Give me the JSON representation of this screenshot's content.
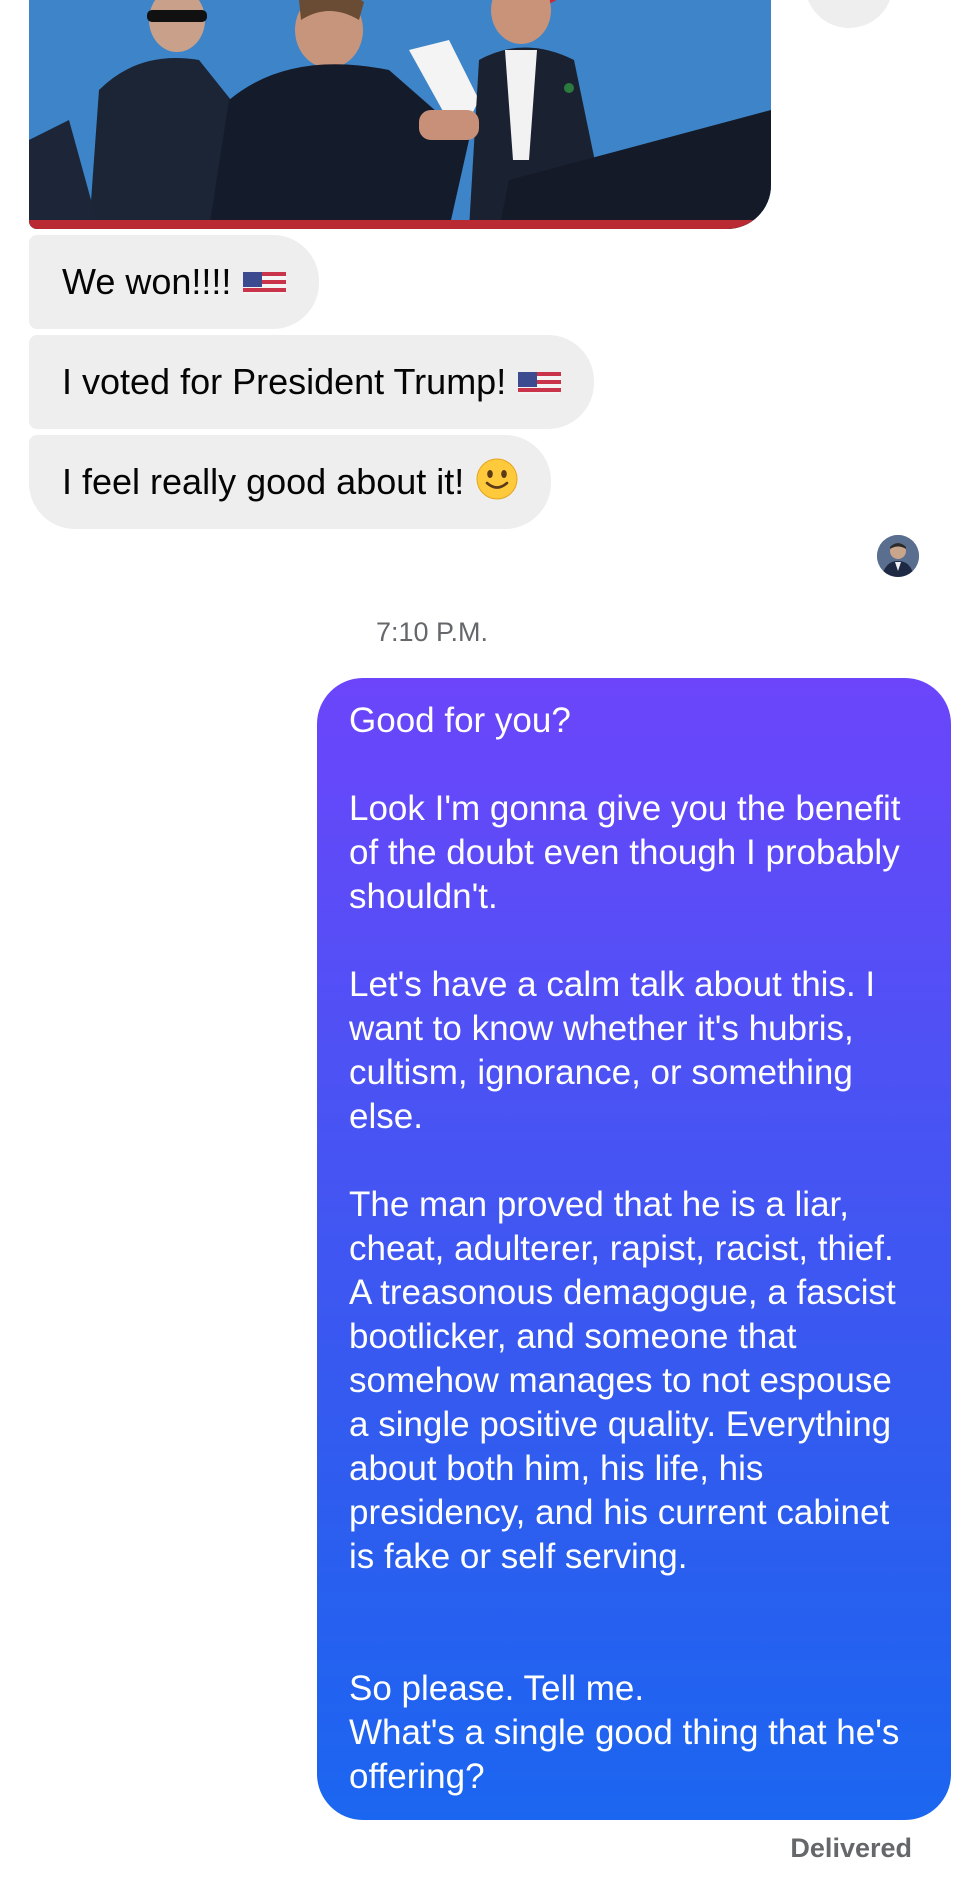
{
  "conversation": {
    "incoming": [
      {
        "text": "We won!!!!",
        "emoji": "us-flag"
      },
      {
        "text": "I voted for President Trump!",
        "emoji": "us-flag"
      },
      {
        "text": "I feel really good about it!",
        "emoji": "slightly-smiling-face"
      }
    ],
    "timestamp": "7:10 P.M.",
    "outgoing": {
      "paragraphs": [
        "Good for you?",
        "Look I'm gonna give you the benefit of the doubt even though I probably shouldn't.",
        "Let's have a calm talk about this. I want to know whether it's hubris, cultism, ignorance, or something else.",
        "The man proved that he is a liar, cheat, adulterer, rapist, racist, thief. A treasonous demagogue, a fascist bootlicker, and someone that somehow manages to not espouse a single positive quality. Everything about both him, his life, his presidency, and his current cabinet is fake or self serving.",
        "So please. Tell me.\nWhat's a single good thing that he's offering?"
      ]
    },
    "status": "Delivered"
  },
  "colors": {
    "incoming_bubble": "#eeeeee",
    "outgoing_gradient_top": "#6c45fb",
    "outgoing_gradient_bottom": "#1b66f0",
    "meta_text": "#65676b"
  },
  "icons": {
    "top_action": "action-icon",
    "read_receipt": "avatar"
  }
}
